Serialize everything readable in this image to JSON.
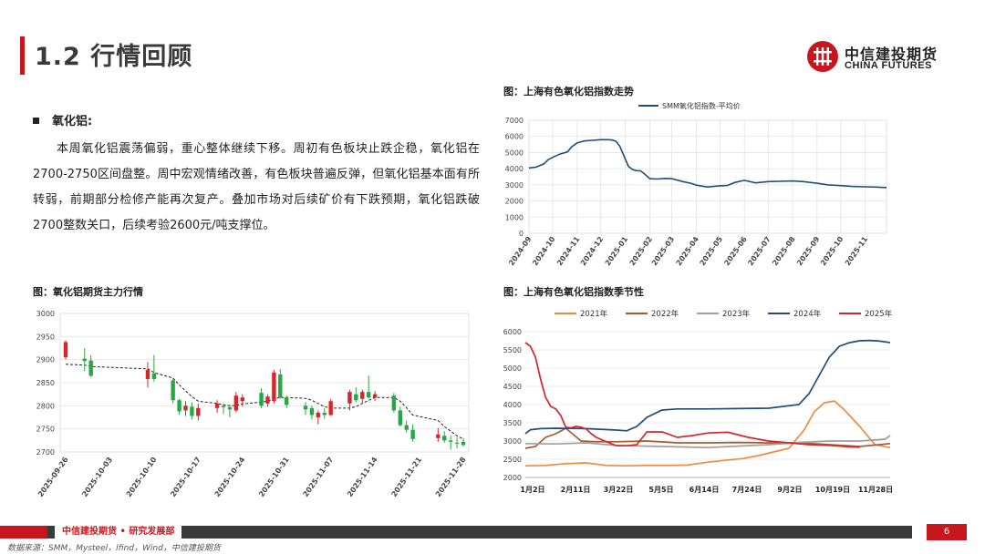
{
  "header": {
    "title": "1.2 行情回顾"
  },
  "logo": {
    "cn": "中信建投期货",
    "en": "CHINA FUTURES"
  },
  "section": {
    "heading": "氧化铝:",
    "body": "本周氧化铝震荡偏弱，重心整体继续下移。周初有色板块止跌企稳，氧化铝在2700-2750区间盘整。周中宏观情绪改善，有色板块普遍反弹，但氧化铝基本面有所转弱，前期部分检修产能再次复产。叠加市场对后续矿价有下跌预期，氧化铝跌破2700整数关口，后续考验2600元/吨支撑位。"
  },
  "figures": {
    "top_right_title": "图：上海有色氧化铝指数走势",
    "bottom_left_title": "图：氧化铝期货主力行情",
    "bottom_right_title": "图：上海有色氧化铝指数季节性"
  },
  "footer": {
    "org": "中信建投期货 • 研究发展部",
    "page": "6",
    "source": "数据来源：SMM，Mysteel，Ifind，Wind，中信建投期货"
  },
  "colors": {
    "brand_red": "#c8161e",
    "up": "#d7262b",
    "down": "#27a844",
    "line": "#1f4e79"
  },
  "chart_data": [
    {
      "type": "line",
      "title": "图：上海有色氧化铝指数走势",
      "series": [
        {
          "name": "SMM氧化铝指数-平均价",
          "color": "#1f4e79",
          "x": [
            "2024-09-01",
            "2024-09-10",
            "2024-09-20",
            "2024-09-25",
            "2024-10-01",
            "2024-10-10",
            "2024-10-20",
            "2024-10-25",
            "2024-11-01",
            "2024-11-10",
            "2024-11-20",
            "2024-12-01",
            "2024-12-10",
            "2024-12-15",
            "2024-12-20",
            "2024-12-25",
            "2025-01-01",
            "2025-01-05",
            "2025-01-10",
            "2025-01-15",
            "2025-01-20",
            "2025-01-25",
            "2025-02-01",
            "2025-02-10",
            "2025-02-20",
            "2025-03-01",
            "2025-03-15",
            "2025-03-25",
            "2025-04-01",
            "2025-04-15",
            "2025-05-01",
            "2025-05-10",
            "2025-05-20",
            "2025-06-01",
            "2025-06-15",
            "2025-07-01",
            "2025-07-15",
            "2025-08-01",
            "2025-08-15",
            "2025-09-01",
            "2025-09-15",
            "2025-10-01",
            "2025-10-15",
            "2025-11-01",
            "2025-11-15",
            "2025-11-28"
          ],
          "y": [
            4050,
            4100,
            4300,
            4550,
            4700,
            4900,
            5050,
            5350,
            5600,
            5720,
            5760,
            5800,
            5800,
            5780,
            5700,
            5400,
            4600,
            4150,
            3950,
            3880,
            3870,
            3700,
            3380,
            3360,
            3400,
            3380,
            3200,
            3100,
            2980,
            2870,
            2940,
            2960,
            3150,
            3280,
            3120,
            3200,
            3220,
            3240,
            3200,
            3100,
            3000,
            2950,
            2900,
            2880,
            2860,
            2830
          ]
        }
      ],
      "x_ticks": [
        "2024-09",
        "2024-10",
        "2024-11",
        "2024-12",
        "2025-01",
        "2025-02",
        "2025-03",
        "2025-04",
        "2025-05",
        "2025-06",
        "2025-07",
        "2025-08",
        "2025-09",
        "2025-10",
        "2025-11"
      ],
      "ylim": [
        0,
        7000
      ],
      "y_ticks": [
        0,
        1000,
        2000,
        3000,
        4000,
        5000,
        6000,
        7000
      ],
      "legend": "top",
      "grid": true
    },
    {
      "type": "candlestick",
      "title": "图：氧化铝期货主力行情",
      "ylim": [
        2700,
        3000
      ],
      "y_ticks": [
        2700,
        2750,
        2800,
        2850,
        2900,
        2950,
        3000
      ],
      "x_ticks": [
        "2025-09-26",
        "2025-10-03",
        "2025-10-10",
        "2025-10-17",
        "2025-10-24",
        "2025-10-31",
        "2025-11-07",
        "2025-11-14",
        "2025-11-21",
        "2025-11-28"
      ],
      "candles": [
        {
          "d": "2025-09-26",
          "o": 2905,
          "h": 2942,
          "l": 2900,
          "c": 2938
        },
        {
          "d": "2025-09-29",
          "o": 2902,
          "h": 2925,
          "l": 2875,
          "c": 2897
        },
        {
          "d": "2025-09-30",
          "o": 2898,
          "h": 2910,
          "l": 2862,
          "c": 2865
        },
        {
          "d": "2025-10-09",
          "o": 2858,
          "h": 2895,
          "l": 2840,
          "c": 2878
        },
        {
          "d": "2025-10-10",
          "o": 2870,
          "h": 2910,
          "l": 2852,
          "c": 2858
        },
        {
          "d": "2025-10-13",
          "o": 2855,
          "h": 2858,
          "l": 2805,
          "c": 2812
        },
        {
          "d": "2025-10-14",
          "o": 2812,
          "h": 2815,
          "l": 2780,
          "c": 2788
        },
        {
          "d": "2025-10-15",
          "o": 2790,
          "h": 2810,
          "l": 2778,
          "c": 2800
        },
        {
          "d": "2025-10-16",
          "o": 2798,
          "h": 2808,
          "l": 2770,
          "c": 2778
        },
        {
          "d": "2025-10-17",
          "o": 2778,
          "h": 2805,
          "l": 2768,
          "c": 2795
        },
        {
          "d": "2025-10-20",
          "o": 2795,
          "h": 2812,
          "l": 2785,
          "c": 2805
        },
        {
          "d": "2025-10-21",
          "o": 2800,
          "h": 2805,
          "l": 2782,
          "c": 2797
        },
        {
          "d": "2025-10-22",
          "o": 2797,
          "h": 2803,
          "l": 2775,
          "c": 2792
        },
        {
          "d": "2025-10-23",
          "o": 2790,
          "h": 2830,
          "l": 2786,
          "c": 2822
        },
        {
          "d": "2025-10-24",
          "o": 2810,
          "h": 2825,
          "l": 2798,
          "c": 2818
        },
        {
          "d": "2025-10-27",
          "o": 2828,
          "h": 2838,
          "l": 2795,
          "c": 2800
        },
        {
          "d": "2025-10-28",
          "o": 2805,
          "h": 2825,
          "l": 2798,
          "c": 2820
        },
        {
          "d": "2025-10-29",
          "o": 2810,
          "h": 2878,
          "l": 2805,
          "c": 2872
        },
        {
          "d": "2025-10-30",
          "o": 2868,
          "h": 2880,
          "l": 2815,
          "c": 2818
        },
        {
          "d": "2025-10-31",
          "o": 2818,
          "h": 2822,
          "l": 2795,
          "c": 2802
        },
        {
          "d": "2025-11-03",
          "o": 2800,
          "h": 2808,
          "l": 2780,
          "c": 2792
        },
        {
          "d": "2025-11-04",
          "o": 2795,
          "h": 2800,
          "l": 2770,
          "c": 2780
        },
        {
          "d": "2025-11-05",
          "o": 2775,
          "h": 2790,
          "l": 2760,
          "c": 2785
        },
        {
          "d": "2025-11-06",
          "o": 2785,
          "h": 2795,
          "l": 2772,
          "c": 2780
        },
        {
          "d": "2025-11-07",
          "o": 2780,
          "h": 2815,
          "l": 2778,
          "c": 2810
        },
        {
          "d": "2025-11-10",
          "o": 2805,
          "h": 2835,
          "l": 2790,
          "c": 2830
        },
        {
          "d": "2025-11-11",
          "o": 2825,
          "h": 2840,
          "l": 2808,
          "c": 2812
        },
        {
          "d": "2025-11-12",
          "o": 2815,
          "h": 2835,
          "l": 2805,
          "c": 2830
        },
        {
          "d": "2025-11-13",
          "o": 2830,
          "h": 2865,
          "l": 2815,
          "c": 2818
        },
        {
          "d": "2025-11-14",
          "o": 2818,
          "h": 2832,
          "l": 2810,
          "c": 2825
        },
        {
          "d": "2025-11-17",
          "o": 2822,
          "h": 2828,
          "l": 2785,
          "c": 2790
        },
        {
          "d": "2025-11-18",
          "o": 2790,
          "h": 2798,
          "l": 2755,
          "c": 2758
        },
        {
          "d": "2025-11-19",
          "o": 2758,
          "h": 2768,
          "l": 2742,
          "c": 2748
        },
        {
          "d": "2025-11-20",
          "o": 2748,
          "h": 2760,
          "l": 2722,
          "c": 2728
        },
        {
          "d": "2025-11-24",
          "o": 2730,
          "h": 2752,
          "l": 2722,
          "c": 2738
        },
        {
          "d": "2025-11-25",
          "o": 2735,
          "h": 2745,
          "l": 2720,
          "c": 2725
        },
        {
          "d": "2025-11-26",
          "o": 2725,
          "h": 2735,
          "l": 2705,
          "c": 2722
        },
        {
          "d": "2025-11-27",
          "o": 2720,
          "h": 2732,
          "l": 2708,
          "c": 2718
        },
        {
          "d": "2025-11-28",
          "o": 2722,
          "h": 2730,
          "l": 2712,
          "c": 2715
        }
      ],
      "ma": [
        2890,
        2888,
        2885,
        2880,
        2872,
        2860,
        2845,
        2832,
        2820,
        2810,
        2805,
        2802,
        2800,
        2800,
        2804,
        2808,
        2810,
        2815,
        2818,
        2818,
        2816,
        2812,
        2805,
        2798,
        2795,
        2795,
        2798,
        2805,
        2812,
        2818,
        2818,
        2810,
        2796,
        2780,
        2768,
        2755,
        2745,
        2735,
        2728
      ]
    },
    {
      "type": "line",
      "title": "图：上海有色氧化铝指数季节性",
      "x_ticks": [
        "1月2日",
        "2月11日",
        "3月22日",
        "5月5日",
        "6月14日",
        "7月24日",
        "9月2日",
        "10月19日",
        "11月28日"
      ],
      "ylim": [
        2000,
        6000
      ],
      "y_ticks": [
        2000,
        2500,
        3000,
        3500,
        4000,
        4500,
        5000,
        5500,
        6000
      ],
      "legend": "top",
      "series": [
        {
          "name": "2021年",
          "color": "#f08a3c",
          "x": [
            0,
            20,
            40,
            60,
            80,
            100,
            120,
            140,
            160,
            180,
            200,
            215,
            230,
            245,
            260,
            275,
            285,
            295,
            305,
            315,
            330,
            345,
            360
          ],
          "y": [
            2320,
            2330,
            2380,
            2400,
            2330,
            2320,
            2330,
            2330,
            2340,
            2420,
            2480,
            2520,
            2600,
            2700,
            2800,
            3300,
            3800,
            4050,
            4100,
            3850,
            3400,
            2900,
            2820
          ]
        },
        {
          "name": "2022年",
          "color": "#a85a2a",
          "x": [
            0,
            10,
            20,
            30,
            40,
            55,
            70,
            90,
            120,
            150,
            180,
            210,
            240,
            270,
            300,
            330,
            360
          ],
          "y": [
            2800,
            2850,
            3100,
            3200,
            3350,
            3000,
            2980,
            2980,
            3000,
            2950,
            2950,
            2960,
            2950,
            2950,
            2900,
            2850,
            2930
          ]
        },
        {
          "name": "2023年",
          "color": "#9e9e9e",
          "x": [
            0,
            30,
            60,
            90,
            120,
            150,
            180,
            210,
            240,
            270,
            300,
            330,
            355,
            360
          ],
          "y": [
            2930,
            2920,
            2950,
            2880,
            2860,
            2840,
            2820,
            2860,
            2900,
            2960,
            3000,
            3000,
            3050,
            3150
          ]
        },
        {
          "name": "2024年",
          "color": "#1f4e79",
          "x": [
            0,
            5,
            15,
            30,
            60,
            90,
            100,
            110,
            120,
            135,
            150,
            180,
            210,
            240,
            270,
            280,
            290,
            300,
            310,
            320,
            330,
            340,
            350,
            360
          ],
          "y": [
            3200,
            3310,
            3340,
            3350,
            3340,
            3300,
            3280,
            3400,
            3650,
            3850,
            3880,
            3880,
            3890,
            3900,
            4000,
            4300,
            4800,
            5300,
            5600,
            5700,
            5750,
            5760,
            5740,
            5700
          ]
        },
        {
          "name": "2025年",
          "color": "#d7262b",
          "x": [
            0,
            5,
            10,
            15,
            20,
            25,
            30,
            35,
            40,
            45,
            50,
            55,
            60,
            65,
            70,
            80,
            90,
            100,
            110,
            120,
            135,
            150,
            165,
            180,
            200,
            220,
            240,
            260,
            280,
            300,
            320,
            330
          ],
          "y": [
            5700,
            5600,
            5300,
            4700,
            4200,
            3950,
            3880,
            3700,
            3380,
            3360,
            3400,
            3380,
            3330,
            3200,
            3100,
            2980,
            2870,
            2870,
            2900,
            3250,
            3250,
            3100,
            3150,
            3220,
            3240,
            3100,
            3000,
            2950,
            2900,
            2880,
            2840,
            2830
          ]
        }
      ]
    }
  ]
}
